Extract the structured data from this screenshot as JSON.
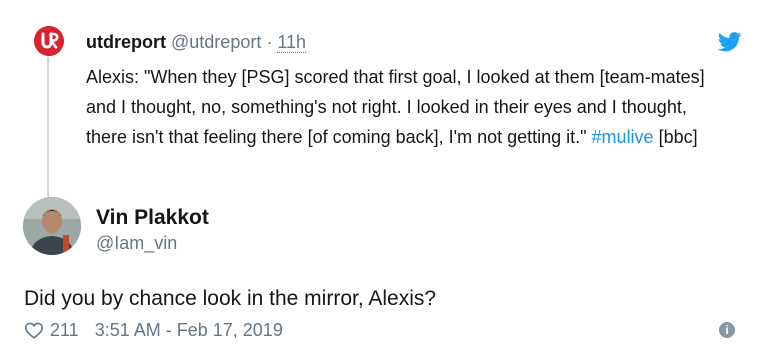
{
  "quoted_tweet": {
    "author_name": "utdreport",
    "author_handle": "@utdreport",
    "separator": "·",
    "time": "11h",
    "text_main": "Alexis: \"When they [PSG] scored that first goal, I looked at them [team-mates] and I thought, no, something's not right. I looked in their eyes and I thought, there isn't that feeling there [of coming back], I'm not getting it.\"",
    "hashtag": "#mulive",
    "text_tail": "[bbc]",
    "brand_color": "#d82331"
  },
  "tweet": {
    "author_name": "Vin Plakkot",
    "author_handle": "@Iam_vin",
    "text": "Did you by chance look in the mirror, Alexis?",
    "like_count": "211",
    "timestamp": "3:51 AM - Feb 17, 2019"
  },
  "icons": {
    "twitter": "twitter-bird-icon",
    "like": "heart-outline-icon",
    "info": "info-circle-icon"
  },
  "colors": {
    "text": "#14171a",
    "secondary": "#657786",
    "link": "#1b95e0",
    "twitter_blue": "#1da1f2"
  }
}
